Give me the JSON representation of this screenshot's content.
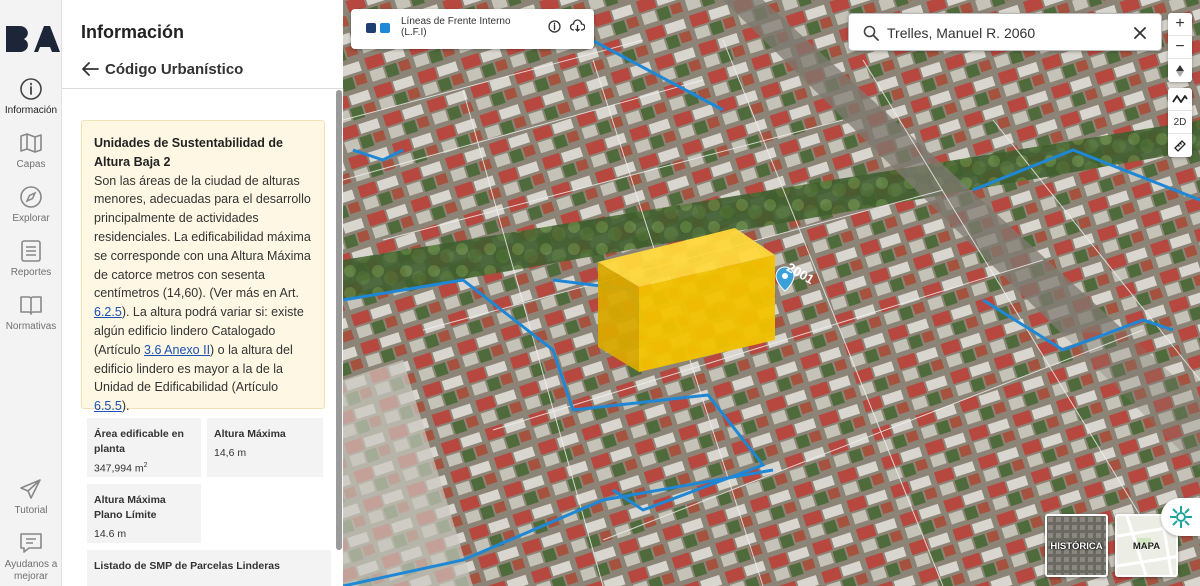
{
  "nav": {
    "items": [
      {
        "label": "Información"
      },
      {
        "label": "Capas"
      },
      {
        "label": "Explorar"
      },
      {
        "label": "Reportes"
      },
      {
        "label": "Normativas"
      },
      {
        "label": "Tutorial"
      },
      {
        "label": "Ayudanos a mejorar"
      }
    ]
  },
  "panel": {
    "title": "Información",
    "subtitle": "Código Urbanístico",
    "card": {
      "title": "Unidades de Sustentabilidad de Altura Baja 2",
      "text1": "Son las áreas de la ciudad de alturas menores, adecuadas para el desarrollo principalmente de actividades residenciales. La edificabilidad máxima se corresponde con una Altura Máxima de catorce metros con sesenta centímetros (14,60). (Ver más en Art. ",
      "link1": "6.2.5",
      "text2": "). La altura podrá variar si: existe algún edificio lindero Catalogado (Artículo ",
      "link2": "3.6 Anexo II",
      "text3": ") o la altura del edificio lindero es mayor a la de la Unidad de Edificabilidad (Artículo ",
      "link3": "6.5.5",
      "text4": ")."
    },
    "tiles": [
      {
        "label": "Área edificable en planta",
        "value": "347,994 m",
        "sup": "2"
      },
      {
        "label": "Altura Máxima",
        "value": "14,6 m"
      },
      {
        "label": "Altura Máxima Plano Límite",
        "value": "14.6 m"
      },
      {
        "label": "Listado de SMP de Parcelas Linderas"
      }
    ]
  },
  "map": {
    "layer": {
      "name_line1": "Líneas de Frente Interno",
      "name_line2": "(L.F.I)"
    },
    "search": {
      "value": "Trelles, Manuel R. 2060"
    },
    "street_label": "2001",
    "controls": {
      "zoom_in": "+",
      "zoom_out": "−",
      "mode_2d": "2D"
    },
    "basemaps": [
      {
        "label": "HISTÓRICA"
      },
      {
        "label": "MAPA"
      }
    ]
  },
  "colors": {
    "accent_blue": "#1e87d6",
    "building_yellow": "#f2c200",
    "card_bg": "#fdf7e4"
  }
}
